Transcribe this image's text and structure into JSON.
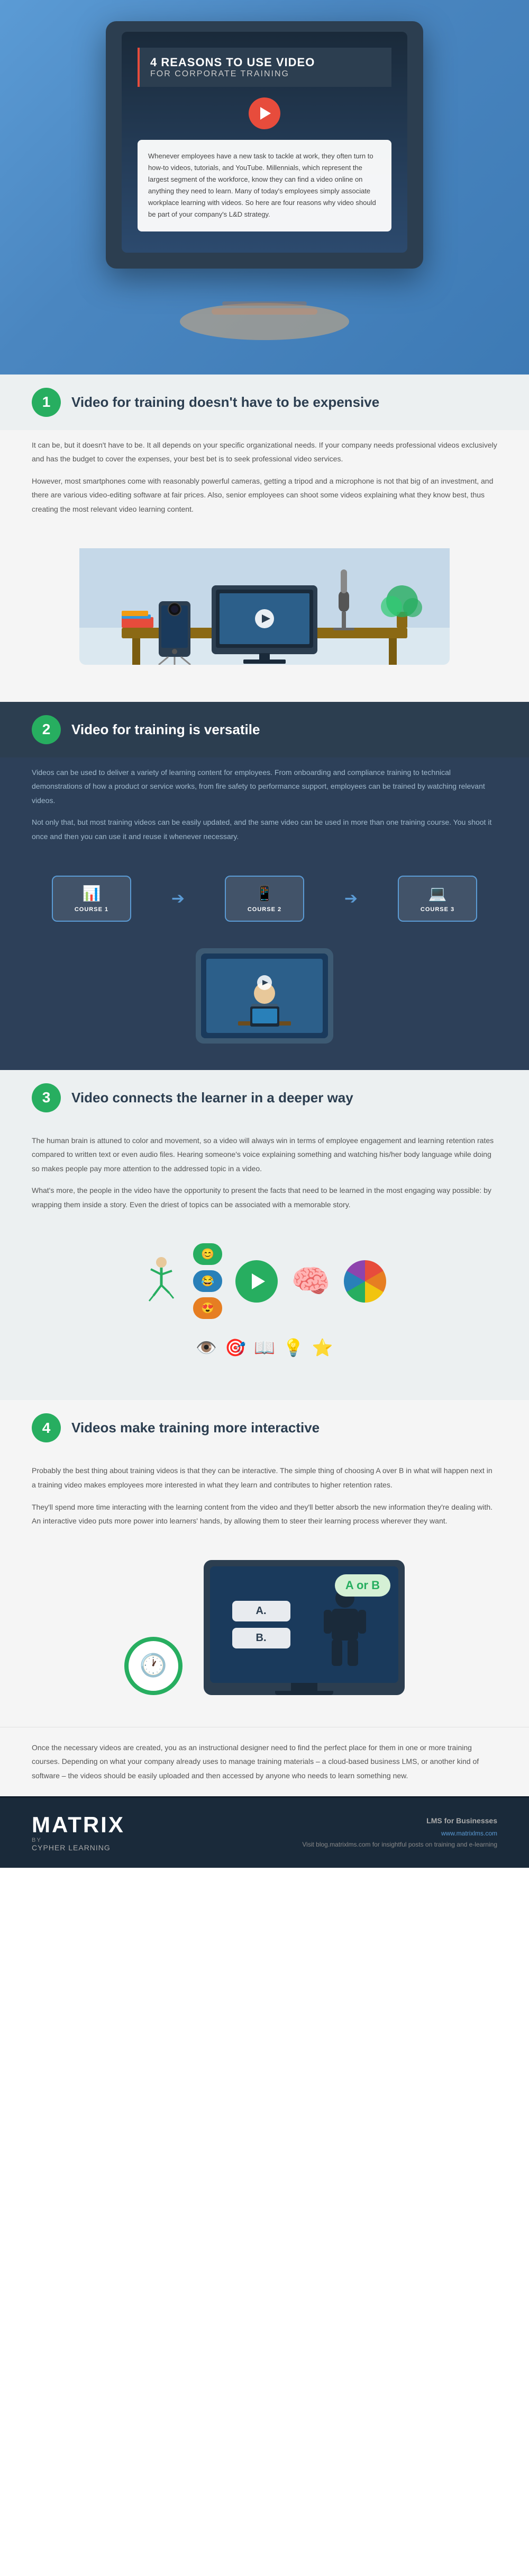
{
  "hero": {
    "title_line1": "4 REASONS TO USE VIDEO",
    "title_line2": "FOR CORPORATE TRAINING",
    "body_text": "Whenever employees have a new task to tackle at work, they often turn to how-to videos, tutorials, and YouTube. Millennials, which represent the largest segment of the workforce, know they can find a video online on anything they need to learn. Many of today's employees simply associate workplace learning with videos. So here are four reasons why video should be part of your company's L&D strategy."
  },
  "section1": {
    "number": "1",
    "heading": "Video for training doesn't have to be expensive",
    "para1": "It can be, but it doesn't have to be. It all depends on your specific organizational needs. If your company needs professional videos exclusively and has the budget to cover the expenses, your best bet is to seek professional video services.",
    "para2": "However, most smartphones come with reasonably powerful cameras, getting a tripod and a microphone is not that big of an investment, and there are various video-editing software at fair prices. Also, senior employees can shoot some videos explaining what they know best, thus creating the most relevant video learning content."
  },
  "section2": {
    "number": "2",
    "heading": "Video for training is versatile",
    "para1": "Videos can be used to deliver a variety of learning content for employees. From onboarding and compliance training to technical demonstrations of how a product or service works, from fire safety to performance support, employees can be trained by watching relevant videos.",
    "para2": "Not only that, but most training videos can be easily updated, and the same video can be used in more than one training course. You shoot it once and then you can use it and reuse it whenever necessary.",
    "courses": [
      {
        "label": "COURSE 1",
        "icon": "📊"
      },
      {
        "label": "COURSE 2",
        "icon": "📱"
      },
      {
        "label": "COURSE 3",
        "icon": "💻"
      }
    ]
  },
  "section3": {
    "number": "3",
    "heading": "Video connects the learner in a deeper way",
    "para1": "The human brain is attuned to color and movement, so a video will always win in terms of employee engagement and learning retention rates compared to written text or even audio files. Hearing someone's voice explaining something and watching his/her body language while doing so makes people pay more attention to the addressed topic in a video.",
    "para2": "What's more, the people in the video have the opportunity to present the facts that need to be learned in the most engaging way possible: by wrapping them inside a story. Even the driest of topics can be associated with a memorable story.",
    "icons": [
      {
        "emoji": "😊",
        "color": "#27ae60"
      },
      {
        "emoji": "😂",
        "color": "#e67e22"
      },
      {
        "emoji": "😍",
        "color": "#e74c3c"
      },
      {
        "emoji": "💬",
        "color": "#2980b9"
      },
      {
        "emoji": "▶️",
        "color": "#27ae60"
      },
      {
        "emoji": "🧠",
        "color": "#8e44ad"
      }
    ]
  },
  "section4": {
    "number": "4",
    "heading": "Videos make training more interactive",
    "para1": "Probably the best thing about training videos is that they can be interactive. The simple thing of choosing A over B in what will happen next in a training video makes employees more interested in what they learn and contributes to higher retention rates.",
    "para2": "They'll spend more time interacting with the learning content from the video and they'll better absorb the new information they're dealing with. An interactive video puts more power into learners' hands, by allowing them to steer their learning process wherever they want.",
    "choice_a": "A.",
    "choice_b": "B.",
    "ab_label": "A or B"
  },
  "bottom_text": {
    "para": "Once the necessary videos are created, you as an instructional designer need to find the perfect place for them in one or more training courses. Depending on what your company already uses to manage training materials – a cloud-based business LMS, or another kind of software – the videos should be easily uploaded and then accessed by anyone who needs to learn something new."
  },
  "footer": {
    "brand_name": "MATRIX",
    "by_label": "by CYPHER LEARNING",
    "tagline": "LMS for Businesses",
    "website": "www.matrixlms.com",
    "cta": "Visit blog.matrixlms.com for insightful posts on training and e-learning"
  }
}
